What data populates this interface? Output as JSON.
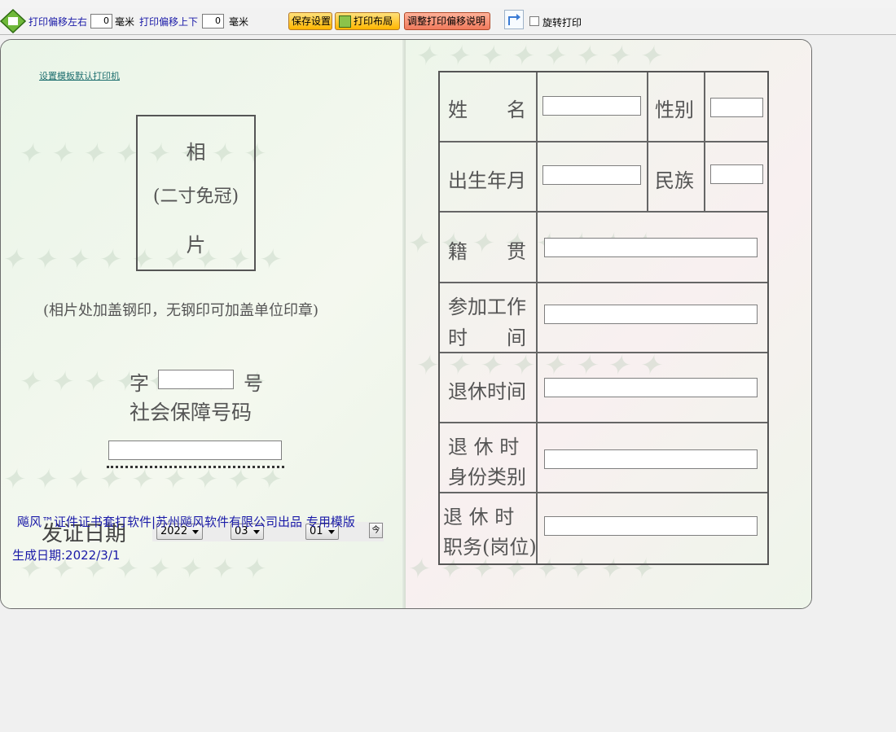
{
  "toolbar": {
    "offset_lr_label": "打印偏移左右",
    "offset_lr_value": "0",
    "unit1": "毫米",
    "offset_ud_label": "打印偏移上下",
    "offset_ud_value": "0",
    "unit2": "毫米",
    "save_label": "保存设置",
    "layout_label": "打印布局",
    "explain_label": "调整打印偏移说明",
    "rotate_label": "旋转打印",
    "rotate_checked": false
  },
  "certificate": {
    "set_printer_link": "设置模板默认打印机",
    "photo_line1": "相",
    "photo_line2": "(二寸免冠)",
    "photo_line3": "片",
    "photo_note": "(相片处加盖钢印，无钢印可加盖单位印章)",
    "zi": "字",
    "hao": "号",
    "ss_label": "社会保障号码",
    "issue_label": "发证日期",
    "year": "2022",
    "month": "03",
    "day": "01",
    "brand": "飚风™证件证书套打软件|苏州飚风软件有限公司出品 专用模版",
    "gen_date": "生成日期:2022/3/1",
    "table": {
      "name": "姓　　名",
      "gender": "性别",
      "birth": "出生年月",
      "ethnicity": "民族",
      "native_place": "籍　　贯",
      "work_start_1": "参加工作",
      "work_start_2": "时　　间",
      "retire_time": "退休时间",
      "retire_id_1": "退 休 时",
      "retire_id_2": "身份类别",
      "retire_pos_1": "退 休 时",
      "retire_pos_2": "职务(岗位)"
    }
  },
  "colors": {
    "link_blue": "#1a1aa8",
    "button_yellow": "#ffb600",
    "button_red": "#f07a5c"
  }
}
